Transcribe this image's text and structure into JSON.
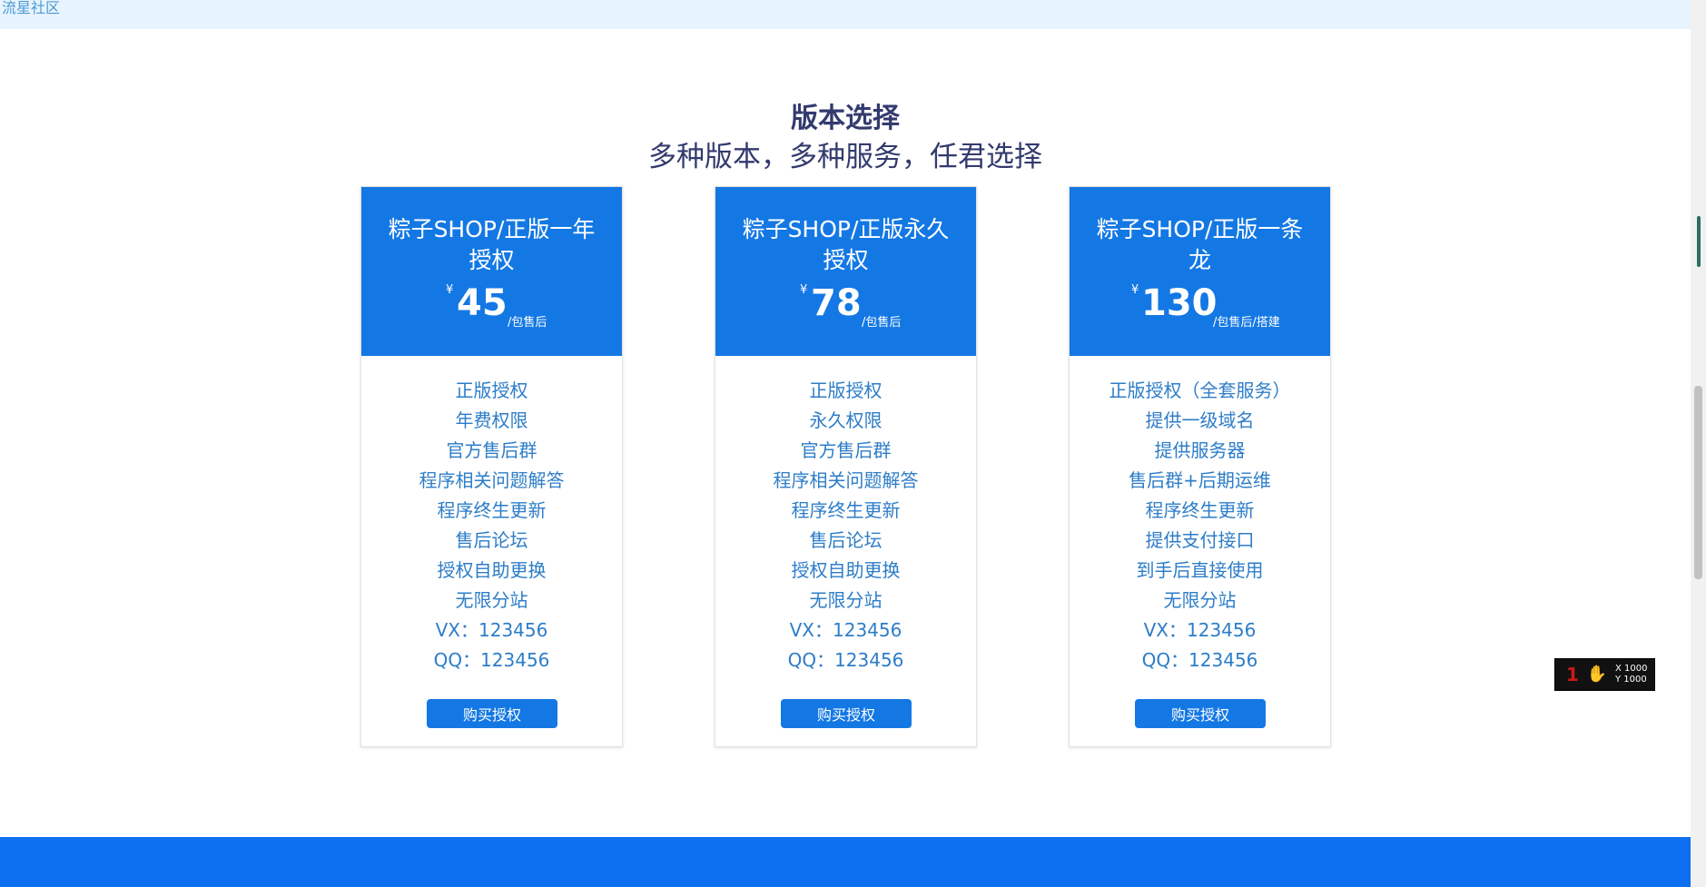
{
  "topbar": {
    "site_name": "流星社区"
  },
  "heading": {
    "title": "版本选择",
    "subtitle": "多种版本，多种服务，任君选择"
  },
  "plans": [
    {
      "title": "粽子SHOP/正版一年授权",
      "currency": "¥",
      "price": "45",
      "unit": "/包售后",
      "features": [
        "正版授权",
        "年费权限",
        "官方售后群",
        "程序相关问题解答",
        "程序终生更新",
        "售后论坛",
        "授权自助更换",
        "无限分站",
        "VX：123456",
        "QQ：123456"
      ],
      "button": "购买授权"
    },
    {
      "title": "粽子SHOP/正版永久授权",
      "currency": "¥",
      "price": "78",
      "unit": "/包售后",
      "features": [
        "正版授权",
        "永久权限",
        "官方售后群",
        "程序相关问题解答",
        "程序终生更新",
        "售后论坛",
        "授权自助更换",
        "无限分站",
        "VX：123456",
        "QQ：123456"
      ],
      "button": "购买授权"
    },
    {
      "title": "粽子SHOP/正版一条龙",
      "currency": "¥",
      "price": "130",
      "unit": "/包售后/搭建",
      "features": [
        "正版授权（全套服务）",
        "提供一级域名",
        "提供服务器",
        "售后群+后期运维",
        "程序终生更新",
        "提供支付接口",
        "到手后直接使用",
        "无限分站",
        "VX：123456",
        "QQ：123456"
      ],
      "button": "购买授权"
    }
  ],
  "widget": {
    "x_label": "X 1000",
    "y_label": "Y 1000"
  }
}
